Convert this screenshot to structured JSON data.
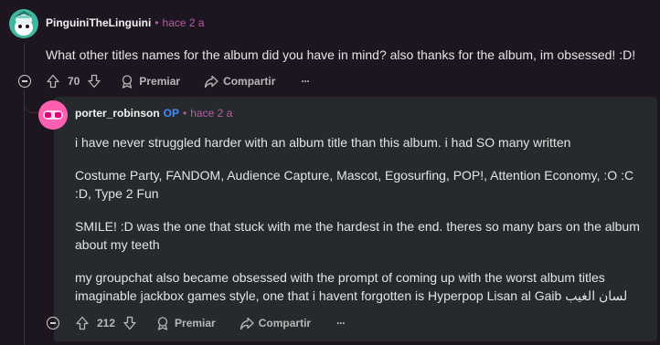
{
  "comment": {
    "username": "PinguiniTheLinguini",
    "separator": "•",
    "time": "hace 2 a",
    "text": "What other titles names for the album did you have in mind? also thanks for the album, im obsessed! :D!",
    "score": "70",
    "award_label": "Premiar",
    "share_label": "Compartir",
    "more_label": "···"
  },
  "reply": {
    "username": "porter_robinson",
    "op_label": "OP",
    "separator": "•",
    "time": "hace 2 a",
    "paragraphs": [
      "i have never struggled harder with an album title than this album. i had SO many written",
      "Costume Party, FANDOM, Audience Capture, Mascot, Egosurfing, POP!, Attention Economy, :O :C :D, Type 2 Fun",
      "SMILE! :D was the one that stuck with me the hardest in the end. theres so many bars on the album about my teeth",
      "my groupchat also became obsessed with the prompt of coming up with the worst album titles imaginable jackbox games style, one that i havent forgotten is Hyperpop Lisan al Gaib لسان الغيب"
    ],
    "score": "212",
    "award_label": "Premiar",
    "share_label": "Compartir",
    "more_label": "···"
  },
  "colors": {
    "background": "#1d1620",
    "reply_panel": "#262a2c",
    "op": "#3d8dff",
    "meta": "#b45fa0"
  }
}
